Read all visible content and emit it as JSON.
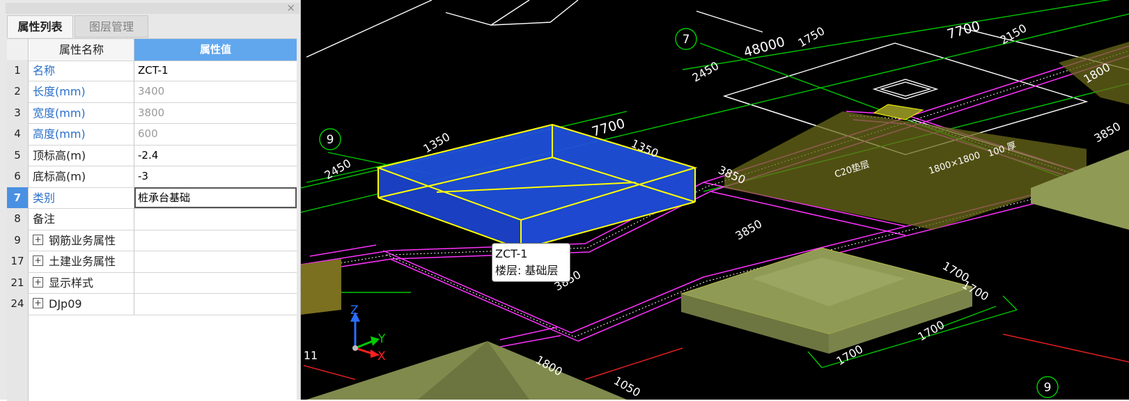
{
  "panel": {
    "tabs": [
      {
        "label": "属性列表"
      },
      {
        "label": "图层管理"
      }
    ],
    "header": {
      "name": "属性名称",
      "value": "属性值"
    },
    "rows": [
      {
        "num": "1",
        "name": "名称",
        "value": "ZCT-1"
      },
      {
        "num": "2",
        "name": "长度(mm)",
        "value": "3400"
      },
      {
        "num": "3",
        "name": "宽度(mm)",
        "value": "3800"
      },
      {
        "num": "4",
        "name": "高度(mm)",
        "value": "600"
      },
      {
        "num": "5",
        "name": "顶标高(m)",
        "value": "-2.4"
      },
      {
        "num": "6",
        "name": "底标高(m)",
        "value": "-3"
      },
      {
        "num": "7",
        "name": "类别",
        "value": "桩承台基础"
      },
      {
        "num": "8",
        "name": "备注",
        "value": ""
      },
      {
        "num": "9",
        "name": "钢筋业务属性",
        "value": ""
      },
      {
        "num": "17",
        "name": "土建业务属性",
        "value": ""
      },
      {
        "num": "21",
        "name": "显示样式",
        "value": ""
      },
      {
        "num": "24",
        "name": "DJp09",
        "value": ""
      }
    ],
    "close_symbol": "×",
    "expander_symbol": "+"
  },
  "viewport": {
    "tooltip": {
      "line1": "ZCT-1",
      "line2": "楼层: 基础层"
    },
    "axes": {
      "z": "Z",
      "y": "Y",
      "x": "X"
    },
    "grid_bubbles": [
      "7",
      "9",
      "9",
      "11"
    ],
    "dimensions": [
      "48000",
      "1750",
      "7700",
      "2150",
      "2450",
      "7700",
      "1350",
      "1350",
      "2450",
      "3850",
      "3850",
      "3850",
      "3850",
      "1700",
      "1700",
      "1700",
      "1700",
      "1800",
      "1800",
      "1050"
    ],
    "colors": {
      "background": "#000000",
      "selected_box": "#1f4fd8",
      "selected_edge": "#ffff00",
      "wall": "#ff33ff",
      "axis_lines": "#00c800",
      "dims": "#ffffff",
      "footing": "#8f9a55"
    }
  }
}
